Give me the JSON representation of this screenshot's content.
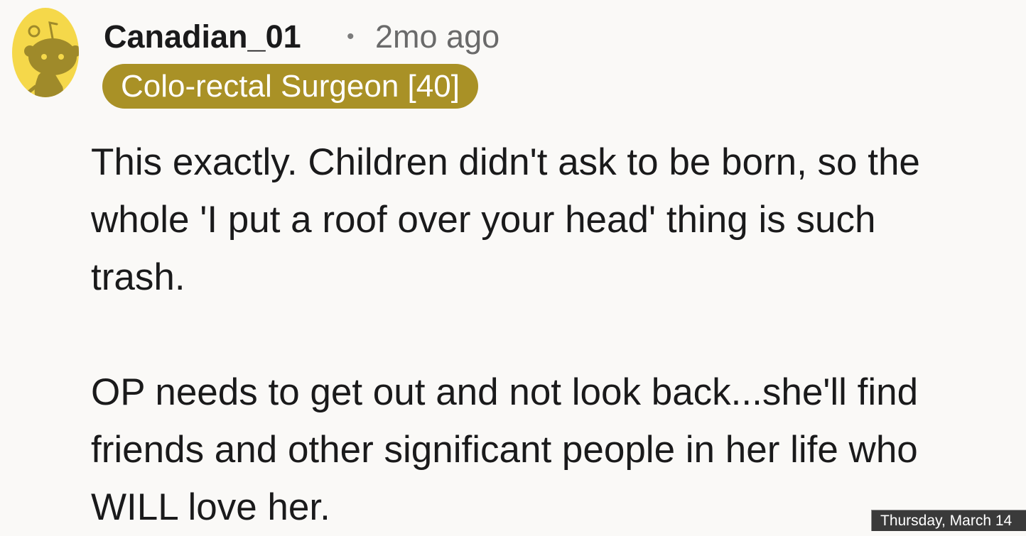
{
  "comment": {
    "avatar_icon": "snoo-avatar-icon",
    "username": "Canadian_01",
    "separator": "•",
    "timestamp": "2mo ago",
    "flair": "Colo-rectal Surgeon [40]",
    "paragraphs": [
      {
        "lines": [
          "This exactly. Children didn't ask to be born, so the",
          "whole 'I put a roof over your head' thing is such",
          "trash."
        ]
      },
      {
        "lines": [
          "OP needs to get out and not look back...she'll find",
          "friends and other significant people in her life who",
          "WILL love her."
        ]
      }
    ]
  },
  "overlay": {
    "date_label": "Thursday, March 14"
  },
  "colors": {
    "background": "#faf9f7",
    "flair_background": "#a99126",
    "avatar_background": "#f5d84a",
    "avatar_figure": "#9f8a2a",
    "text": "#1a1a1b",
    "muted_text": "#6a6a6a"
  }
}
